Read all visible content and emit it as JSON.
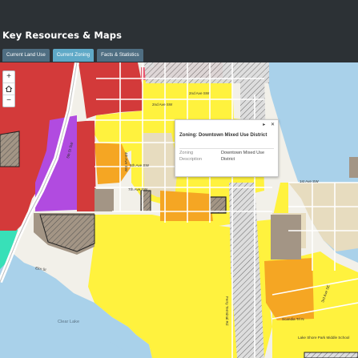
{
  "header": {
    "title": "Key Resources & Maps"
  },
  "tabs": [
    {
      "label": "Current Land Use",
      "active": false
    },
    {
      "label": "Current Zoning",
      "active": true
    },
    {
      "label": "Facts & Statistics",
      "active": false
    }
  ],
  "map": {
    "zoom": {
      "in_label": "+",
      "home_icon": "home-icon",
      "out_label": "−"
    },
    "street_labels": {
      "ave_2nd": "2nd Ave SW",
      "ave_2nd_b": "2nd Ave SW",
      "ave_4th": "4th Ave SW",
      "ave_5th": "5th Ave SW",
      "ave_7th": "7th Ave SW",
      "st_5th": "5th St SW",
      "ave_1st": "1st Ave SW",
      "elm": "Elm St",
      "ferry": "Ferry Terminal Rd",
      "scandia": "Scandia Trl N",
      "st_3rd": "3rd Ave SE"
    },
    "water_label": "Clear Lake",
    "park_label": "Lake Shore Park Middle School"
  },
  "popup": {
    "title": "Zoning: Downtown Mixed Use District",
    "fields": [
      {
        "key": "Zoning",
        "value": "Downtown Mixed Use"
      },
      {
        "key": "Description",
        "value": "District"
      }
    ]
  },
  "colors": {
    "header_bg": "#2c3135",
    "tab_bg": "#4f6e82",
    "tab_active_bg": "#5fa9c7",
    "water": "#a9d1ea",
    "commercial_red": "#d33a3a",
    "residential_yellow": "#fff23e",
    "mixed_use_beige": "#e7dcbf",
    "purple": "#b14be0",
    "orange": "#f5a623",
    "industrial_brown": "#a39585"
  }
}
